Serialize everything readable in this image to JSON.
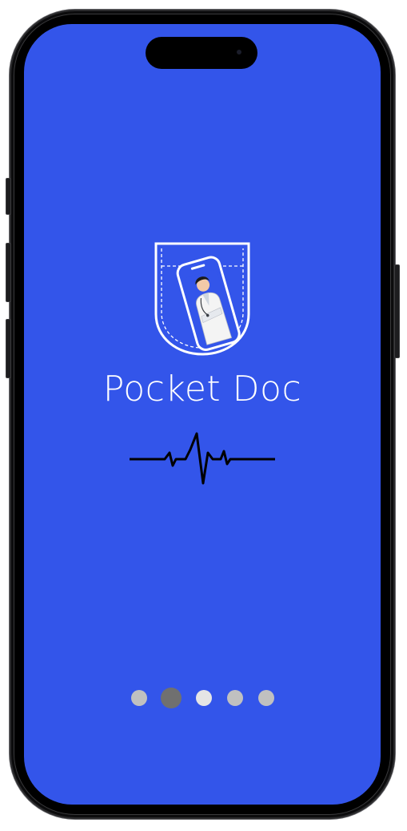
{
  "app": {
    "title": "Pocket Doc"
  },
  "colors": {
    "screen_background": "#3355ea",
    "title_text": "#ffffff",
    "dot_active": "#707070",
    "dot_inactive": "#c0c0c0",
    "dot_light": "#e5e5e5"
  },
  "icons": {
    "logo": "pocket-doctor-icon",
    "heartbeat": "heartbeat-line-icon"
  },
  "pager": {
    "total": 5,
    "active_index": 1
  }
}
